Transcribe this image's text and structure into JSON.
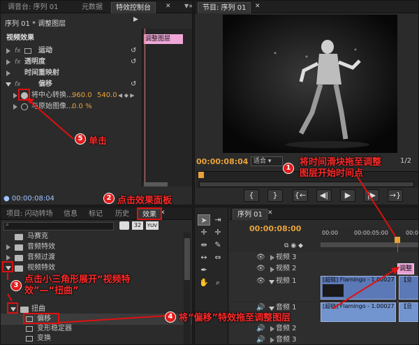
{
  "effect_controls": {
    "tabs": [
      "调音台: 序列 01",
      "元数据",
      "特效控制台"
    ],
    "sequence_label": "序列 01 * 调整图层",
    "clip_tag": "调整图层",
    "video_effects": "视频效果",
    "effects": [
      "运动",
      "透明度",
      "时间重映射",
      "偏移"
    ],
    "offset_params": [
      {
        "name": "将中心转换...",
        "v1": "960.0",
        "v2": "540.0"
      },
      {
        "name": "与原始图像...",
        "v1": "0.0 %"
      }
    ],
    "timecode": "00:00:08:04"
  },
  "program": {
    "tab": "节目: 序列 01",
    "timecode": "00:00:08:04",
    "fit": "适合",
    "ratio": "1/2",
    "buttons": [
      "{",
      "}",
      "{←",
      "◀|",
      "▶",
      "|▶",
      "→}"
    ]
  },
  "effects_panel": {
    "tabs": [
      "项目: 闪动转场",
      "信息",
      "标记",
      "历史",
      "效果"
    ],
    "buttons": [
      "32",
      "YUV"
    ],
    "items": [
      "马赛克",
      "音频特效",
      "音频过渡",
      "视频特效",
      "扭曲",
      "偏移",
      "变形稳定器",
      "变换"
    ]
  },
  "timeline": {
    "tab": "序列 01",
    "timecode": "00:00:08:00",
    "ruler": [
      "00:00",
      "00:00:05:00",
      "00:00"
    ],
    "tracks": [
      "视频 3",
      "视频 2",
      "视频 1",
      "音频 1",
      "音频 2",
      "音频 3"
    ],
    "clip_v2": "调整",
    "clip_v1": "[超链] Flamingo - 1.00027【旦",
    "clip_v1b": "【旦",
    "clip_a1": "[超链] Flamingo - 1.00027【旦",
    "clip_a1b": "【旦"
  },
  "annotations": {
    "a1": "将时间滑块拖至调整图层开始时间点",
    "a2": "点击效果面板",
    "a3": "点击小三角形展开“视频特效”—“扭曲”",
    "a4": "将“偏移”特效拖至调整图层",
    "a5": "单击",
    "n1": "1",
    "n2": "2",
    "n3": "3",
    "n4": "4",
    "n5": "5"
  },
  "colors": {
    "accent": "#e9a23a",
    "annotation": "#e01010",
    "clip": "#5b79b6"
  }
}
